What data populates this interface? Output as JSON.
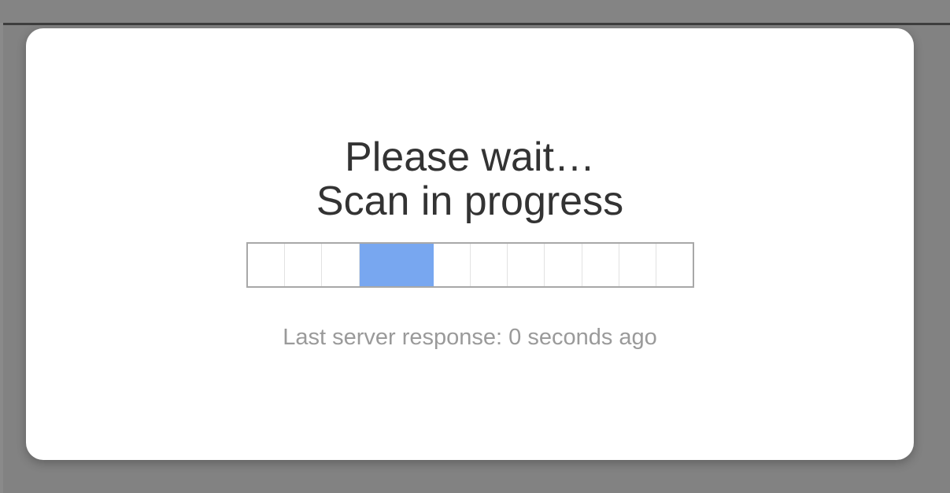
{
  "dialog": {
    "title_line1": "Please wait…",
    "title_line2": "Scan in progress",
    "status_text": "Last server response: 0 seconds ago"
  },
  "progress": {
    "segment_count": 12,
    "active_start": 3,
    "active_length": 2,
    "active_color": "#78a7f0",
    "indeterminate": true
  }
}
